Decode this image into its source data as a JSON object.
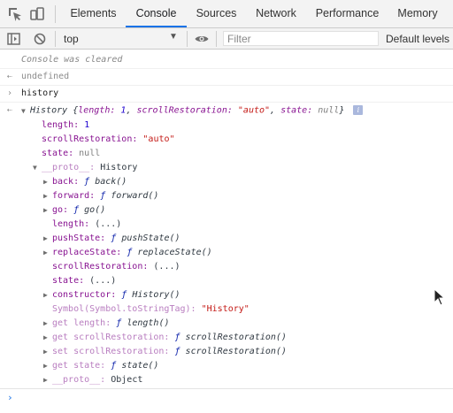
{
  "tabs": [
    {
      "label": "Elements"
    },
    {
      "label": "Console"
    },
    {
      "label": "Sources"
    },
    {
      "label": "Network"
    },
    {
      "label": "Performance"
    },
    {
      "label": "Memory"
    }
  ],
  "toolbar": {
    "context": "top",
    "filter_placeholder": "Filter",
    "levels": "Default levels"
  },
  "console": {
    "cleared_message": "Console was cleared",
    "undefined_result": "undefined",
    "command": "history",
    "result": {
      "type_name": "History",
      "summary_open": "{",
      "summary_length_key": "length:",
      "summary_length_val": "1",
      "summary_sep1": ",",
      "summary_sr_key": "scrollRestoration:",
      "summary_sr_val": "\"auto\"",
      "summary_sep2": ",",
      "summary_state_key": "state:",
      "summary_state_val": "null",
      "summary_close": "}",
      "info_badge": "i",
      "props": [
        {
          "key": "length:",
          "value": "1"
        },
        {
          "key": "scrollRestoration:",
          "value": "\"auto\""
        },
        {
          "key": "state:",
          "value": "null"
        }
      ],
      "proto": {
        "key": "__proto__:",
        "value": "History",
        "items": [
          {
            "key": "back:",
            "f": "ƒ",
            "value": "back()"
          },
          {
            "key": "forward:",
            "f": "ƒ",
            "value": "forward()"
          },
          {
            "key": "go:",
            "f": "ƒ",
            "value": "go()"
          },
          {
            "key": "length:",
            "value": "(...)"
          },
          {
            "key": "pushState:",
            "f": "ƒ",
            "value": "pushState()"
          },
          {
            "key": "replaceState:",
            "f": "ƒ",
            "value": "replaceState()"
          },
          {
            "key": "scrollRestoration:",
            "value": "(...)"
          },
          {
            "key": "state:",
            "value": "(...)"
          },
          {
            "key": "constructor:",
            "f": "ƒ",
            "value": "History()"
          },
          {
            "key": "Symbol(Symbol.toStringTag):",
            "value": "\"History\""
          },
          {
            "key": "get length:",
            "f": "ƒ",
            "value": "length()"
          },
          {
            "key": "get scrollRestoration:",
            "f": "ƒ",
            "value": "scrollRestoration()"
          },
          {
            "key": "set scrollRestoration:",
            "f": "ƒ",
            "value": "scrollRestoration()"
          },
          {
            "key": "get state:",
            "f": "ƒ",
            "value": "state()"
          },
          {
            "key": "__proto__:",
            "value": "Object"
          }
        ]
      }
    }
  },
  "icons": {
    "inspect": "inspect-element-icon",
    "device": "device-toolbar-icon",
    "sidebar": "show-sidebar-icon",
    "clear": "clear-console-icon",
    "eye": "live-expression-eye-icon"
  }
}
